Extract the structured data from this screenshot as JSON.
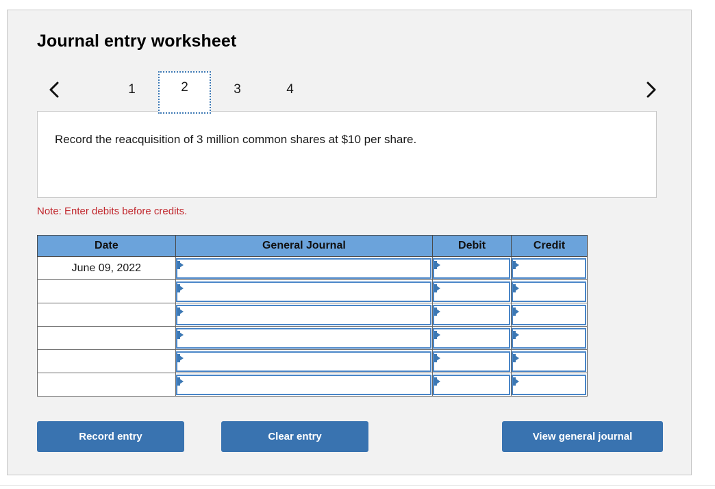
{
  "worksheet": {
    "title": "Journal entry worksheet",
    "nav": {
      "prev_icon": "chevron-left-icon",
      "next_icon": "chevron-right-icon"
    },
    "tabs": [
      {
        "label": "1",
        "active": false
      },
      {
        "label": "2",
        "active": true
      },
      {
        "label": "3",
        "active": false
      },
      {
        "label": "4",
        "active": false
      }
    ],
    "description": "Record the reacquisition of 3 million common shares at $10 per share.",
    "note": "Note: Enter debits before credits.",
    "note_color": "#c1272d"
  },
  "table": {
    "header_color": "#6ba3db",
    "columns": [
      "Date",
      "General Journal",
      "Debit",
      "Credit"
    ],
    "rows": [
      {
        "date": "June 09, 2022",
        "journal": "",
        "debit": "",
        "credit": ""
      },
      {
        "date": "",
        "journal": "",
        "debit": "",
        "credit": ""
      },
      {
        "date": "",
        "journal": "",
        "debit": "",
        "credit": ""
      },
      {
        "date": "",
        "journal": "",
        "debit": "",
        "credit": ""
      },
      {
        "date": "",
        "journal": "",
        "debit": "",
        "credit": ""
      },
      {
        "date": "",
        "journal": "",
        "debit": "",
        "credit": ""
      }
    ]
  },
  "buttons": {
    "record": "Record entry",
    "clear": "Clear entry",
    "view": "View general journal",
    "color": "#3973b0"
  }
}
